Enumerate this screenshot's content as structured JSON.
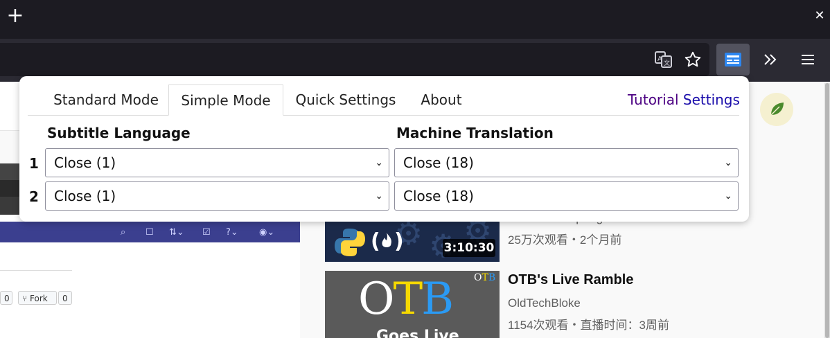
{
  "browser": {
    "new_tab_glyph": "+",
    "close_glyph": "✕",
    "toolbar_icons": [
      "translate-icon",
      "bookmark-star-icon",
      "subtitle-extension-icon",
      "overflow-chevrons-icon",
      "hamburger-menu-icon"
    ]
  },
  "popup": {
    "tabs": [
      "Standard Mode",
      "Simple Mode",
      "Quick Settings",
      "About"
    ],
    "active_tab": "Simple Mode",
    "tutorial": {
      "word1": "Tutorial",
      "word2": "Settings"
    },
    "headers": {
      "subtitle_language": "Subtitle Language",
      "machine_translation": "Machine Translation"
    },
    "rows": [
      {
        "num": "1",
        "subtitle": "Close (1)",
        "translation": "Close (18)"
      },
      {
        "num": "2",
        "subtitle": "Close (1)",
        "translation": "Close (18)"
      }
    ]
  },
  "background": {
    "github": {
      "button_count": "0",
      "fork_label": "Fork",
      "fork_count": "0"
    },
    "video1": {
      "channel": "freecodecamp.org",
      "duration": "3:10:30",
      "meta": "25万次观看・2个月前"
    },
    "video2": {
      "title": "OTB's Live Ramble",
      "channel": "OldTechBloke",
      "meta": "1154次观看・直播时间：3周前",
      "thumb_text": "OTB",
      "thumb_small": "OTB",
      "thumb_sub": "Goes Live"
    }
  },
  "colors": {
    "accent_active_ext": "#52525e",
    "tutorial": "#4b0082",
    "settings_link": "#1a0dab"
  }
}
